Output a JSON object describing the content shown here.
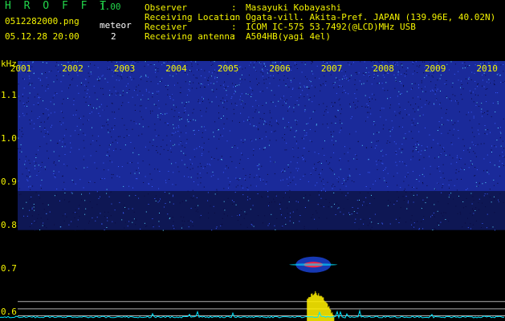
{
  "app": {
    "title": "H R O F F T",
    "version": "1.00"
  },
  "file": {
    "name": "0512282000.png",
    "datetime": "05.12.28 20:00"
  },
  "meteor": {
    "label": "meteor",
    "count": "2"
  },
  "info": [
    {
      "key": "Observer",
      "value": "Masayuki Kobayashi"
    },
    {
      "key": "Receiving Location",
      "value": "Ogata-vill. Akita-Pref. JAPAN (139.96E, 40.02N)"
    },
    {
      "key": "Receiver",
      "value": "ICOM IC-575 53.7492(@LCD)MHz USB"
    },
    {
      "key": "Receiving antenna",
      "value": "A504HB(yagi 4el)"
    }
  ],
  "info_sep": ":",
  "colors": {
    "label": "#f4f400",
    "title": "#22d64a",
    "noise": "#1a2a9a",
    "echo": "#ff2040",
    "bars": "#ffee00",
    "trace": "#00e5ff"
  },
  "chart_data": {
    "type": "heatmap",
    "y_unit": "kHz",
    "y_ticks": [
      "1.1",
      "1.0",
      "0.9",
      "0.8",
      "0.7",
      "0.6"
    ],
    "y_values": [
      1.1,
      1.0,
      0.9,
      0.8,
      0.7,
      0.6
    ],
    "ylim": [
      0.58,
      1.18
    ],
    "x_ticks": [
      "2001",
      "2002",
      "2003",
      "2004",
      "2005",
      "2006",
      "2007",
      "2008",
      "2009",
      "2010"
    ],
    "xlim": [
      2000.6,
      2010.35
    ],
    "echo": {
      "x": 2006.65,
      "y": 0.71
    },
    "legend": "none",
    "grid": false
  }
}
